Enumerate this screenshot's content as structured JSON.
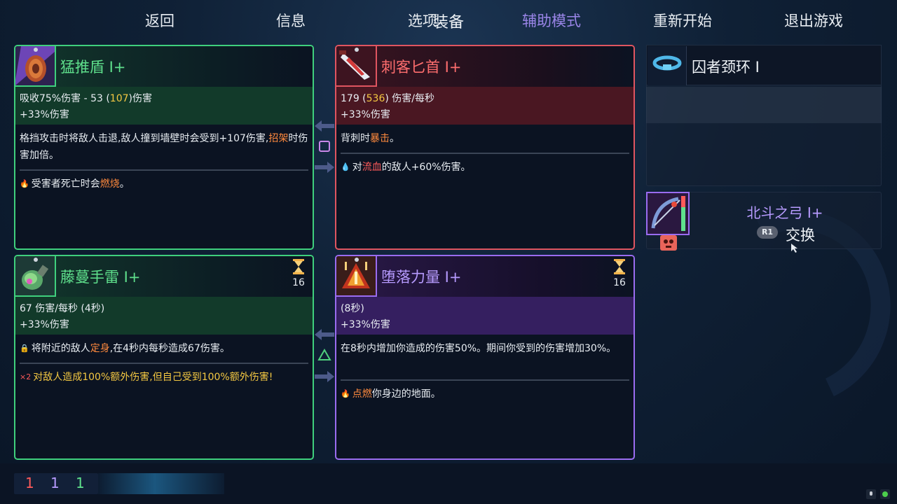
{
  "screen_title": "装备",
  "weapons": {
    "shield": {
      "name": "猛推盾 I+",
      "stat_line1_prefix": "吸收75%伤害 - 53 (",
      "stat_line1_hl": "107",
      "stat_line1_suffix": ")伤害",
      "stat_line2": "+33%伤害",
      "desc_part1": "格挡攻击时将敌人击退,敌人撞到墙壁时会受到+107伤害,",
      "desc_hl": "招架",
      "desc_part2": "时伤害加倍。",
      "effect_prefix": "受害者死亡时会",
      "effect_hl": "燃烧",
      "effect_suffix": "。",
      "color": "#3fd07d"
    },
    "dagger": {
      "name": "刺客匕首 I+",
      "stat_line1_prefix": "179 (",
      "stat_line1_hl": "536",
      "stat_line1_suffix": ") 伤害/每秒",
      "stat_line2": "+33%伤害",
      "desc_prefix": "背刺时",
      "desc_hl": "暴击",
      "desc_suffix": "。",
      "effect_prefix": "对",
      "effect_hl": "流血",
      "effect_suffix": "的敌人+60%伤害。",
      "color": "#e05560"
    }
  },
  "skills": {
    "grenade": {
      "name": "藤蔓手雷 I+",
      "cooldown": "16",
      "stat_line1": "67 伤害/每秒 (4秒)",
      "stat_line2": "+33%伤害",
      "desc_prefix": "将附近的敌人",
      "desc_hl": "定身",
      "desc_suffix": ",在4秒内每秒造成67伤害。",
      "effect": "对敌人造成100%额外伤害,但自己受到100%额外伤害!",
      "color": "#3fd07d"
    },
    "power": {
      "name": "堕落力量 I+",
      "cooldown": "16",
      "stat_line1": "(8秒)",
      "stat_line2": "+33%伤害",
      "desc": "在8秒内增加你造成的伤害50%。期间你受到的伤害增加30%。",
      "effect_hl": "点燃",
      "effect_suffix": "你身边的地面。",
      "color": "#9a6cf0"
    }
  },
  "amulet": {
    "name": "囚者颈环 I"
  },
  "pickup": {
    "name": "北斗之弓 I+",
    "button_glyph": "R1",
    "action": "交换"
  },
  "bottom_bar": {
    "counters": [
      "1",
      "1",
      "1"
    ],
    "counter_colors": [
      "#ff5a5a",
      "#b79bff",
      "#5fe08c"
    ],
    "back": "返回",
    "info": "信息",
    "options": "选项",
    "assist": "辅助模式",
    "restart": "重新开始",
    "quit": "退出游戏"
  }
}
